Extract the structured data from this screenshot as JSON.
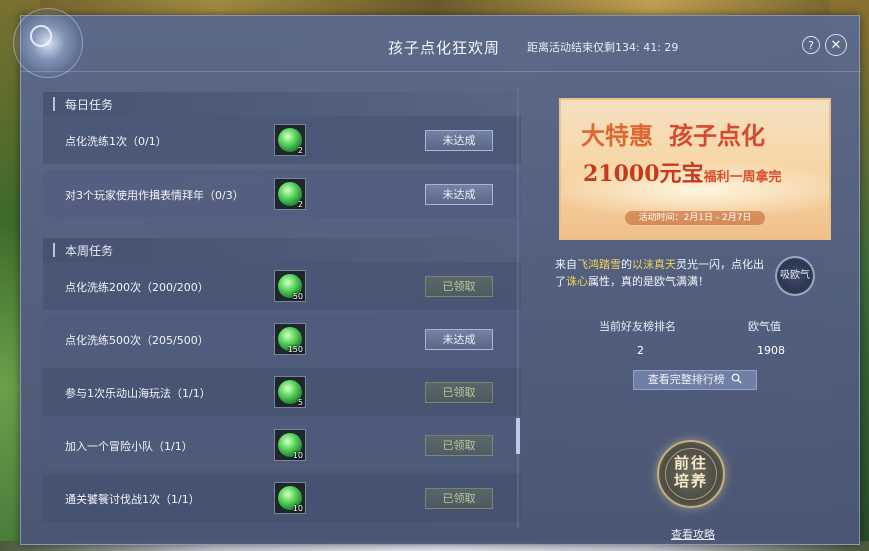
{
  "header": {
    "title": "孩子点化狂欢周",
    "countdown": "距离活动结束仅剩134: 41: 29",
    "help_icon": "?",
    "close_icon": "✕"
  },
  "daily": {
    "title": "每日任务",
    "tasks": [
      {
        "name": "点化洗练1次（0/1）",
        "reward_count": "2",
        "status": "未达成"
      },
      {
        "name": "对3个玩家使用作揖表情拜年（0/3）",
        "reward_count": "2",
        "status": "未达成"
      }
    ]
  },
  "weekly": {
    "title": "本周任务",
    "tasks": [
      {
        "name": "点化洗练200次（200/200）",
        "reward_count": "50",
        "status": "已领取"
      },
      {
        "name": "点化洗练500次（205/500）",
        "reward_count": "150",
        "status": "未达成"
      },
      {
        "name": "参与1次乐动山海玩法（1/1）",
        "reward_count": "5",
        "status": "已领取"
      },
      {
        "name": "加入一个冒险小队（1/1）",
        "reward_count": "10",
        "status": "已领取"
      },
      {
        "name": "通关饕餮讨伐战1次（1/1）",
        "reward_count": "10",
        "status": "已领取"
      }
    ]
  },
  "banner": {
    "tag": "大特惠",
    "headline": "孩子点化",
    "amount": "21000元宝",
    "subline": "福利一周拿完",
    "date": "活动时间：2月1日 - 2月7日"
  },
  "message": {
    "prefix": "来自",
    "server": "飞鸿踏雪",
    "middle": "的",
    "player": "以沫真天",
    "text1": "灵光一闪，点化出了",
    "attr": "诛心",
    "text2": "属性，真的是欧气满满！"
  },
  "absorb_button": "吸欧气",
  "stats": {
    "rank_label": "当前好友榜排名",
    "rank_value": "2",
    "luck_label": "欧气值",
    "luck_value": "1908"
  },
  "rank_button": "查看完整排行榜",
  "go_button": "前往培养",
  "guide_link": "查看攻略",
  "colors": {
    "highlight": "#f3d35c",
    "reward_orb": "#4ecb5a",
    "banner_red": "#d8482e"
  }
}
